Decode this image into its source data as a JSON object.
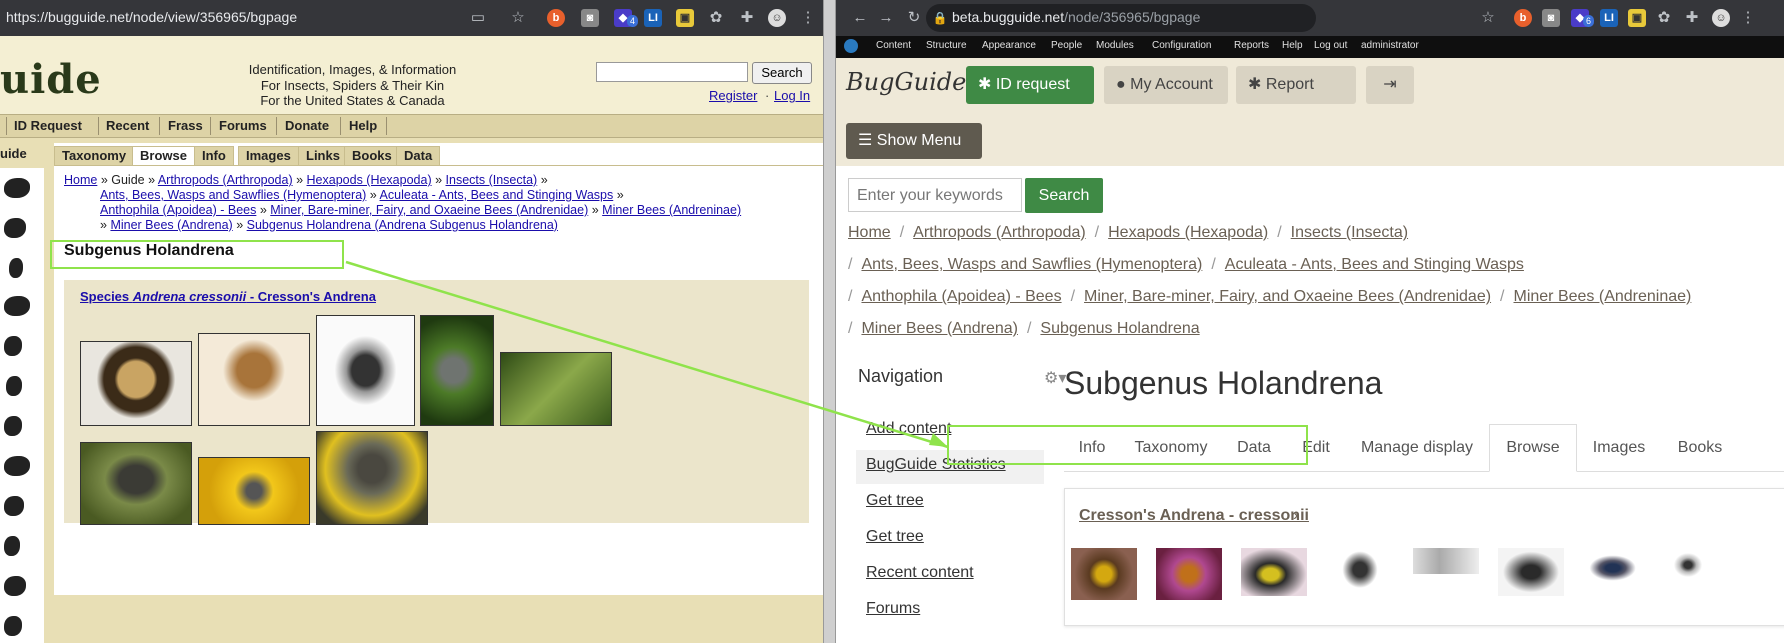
{
  "left": {
    "url": "https://bugguide.net/node/view/356965/bgpage",
    "ext_badge": "4",
    "logo_text": "uide",
    "tagline": [
      "Identification, Images, & Information",
      "For Insects, Spiders & Their Kin",
      "For the United States & Canada"
    ],
    "search_label": "Search",
    "register": "Register",
    "login": "Log In",
    "nav": [
      "ID Request",
      "Recent",
      "Frass",
      "Forums",
      "Donate",
      "Help"
    ],
    "side_label": "uide",
    "tabs": [
      "Taxonomy",
      "Browse",
      "Info",
      "Images",
      "Links",
      "Books",
      "Data"
    ],
    "breadcrumb": {
      "home": "Home",
      "guide": "Guide",
      "arthropods": "Arthropods (Arthropoda)",
      "hexapods": "Hexapods (Hexapoda)",
      "insects": "Insects (Insecta)",
      "hymenoptera": "Ants, Bees, Wasps and Sawflies (Hymenoptera)",
      "aculeata": "Aculeata - Ants, Bees and Stinging Wasps",
      "anthophila": "Anthophila (Apoidea) - Bees",
      "andrenidae": "Miner, Bare-miner, Fairy, and Oxaeine Bees (Andrenidae)",
      "andreninae": "Miner Bees (Andreninae)",
      "andrena": "Miner Bees (Andrena)",
      "holandrena": "Subgenus Holandrena (Andrena Subgenus Holandrena)"
    },
    "title": "Subgenus Holandrena",
    "species": {
      "prefix": "Species ",
      "name": "Andrena cressonii",
      "suffix": " - Cresson's Andrena"
    }
  },
  "right": {
    "url_host": "beta.bugguide.net",
    "url_path": "/node/356965/bgpage",
    "ext_badge": "6",
    "toolbar": [
      "Content",
      "Structure",
      "Appearance",
      "People",
      "Modules",
      "Configuration",
      "Reports",
      "Help",
      "Log out",
      "administrator"
    ],
    "logo_text": "BugGuide",
    "id_request": "ID request",
    "my_account": "My Account",
    "report_bug": "Report Bug",
    "show_menu": "Show Menu",
    "search_placeholder": "Enter your keywords",
    "search_label": "Search",
    "breadcrumb": [
      "Home",
      "Arthropods (Arthropoda)",
      "Hexapods (Hexapoda)",
      "Insects (Insecta)",
      "Ants, Bees, Wasps and Sawflies (Hymenoptera)",
      "Aculeata - Ants, Bees and Stinging Wasps",
      "Anthophila (Apoidea) - Bees",
      "Miner, Bare-miner, Fairy, and Oxaeine Bees (Andrenidae)",
      "Miner Bees (Andreninae)",
      "Miner Bees (Andrena)",
      "Subgenus Holandrena"
    ],
    "nav_title": "Navigation",
    "nav_links": [
      "Add content",
      "BugGuide Statistics",
      "Get tree",
      "Get tree",
      "Recent content",
      "Forums"
    ],
    "title": "Subgenus Holandrena",
    "tabs": [
      "Info",
      "Taxonomy",
      "Data",
      "Edit",
      "Manage display",
      "Browse",
      "Images",
      "Books"
    ],
    "species_link": "Cresson's Andrena - cressonii"
  },
  "colors": {
    "highlight": "#8fe34b",
    "accent_green": "#3f8a45",
    "left_bg": "#e8dfb5"
  }
}
